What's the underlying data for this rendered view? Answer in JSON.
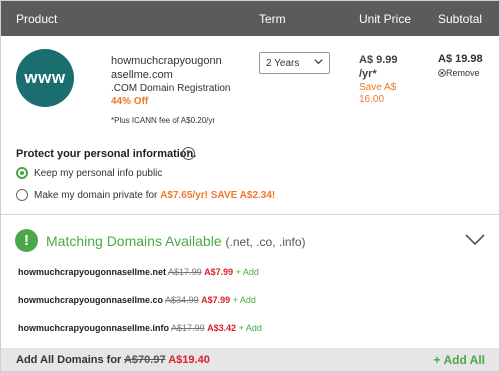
{
  "header": {
    "product": "Product",
    "term": "Term",
    "unit_price": "Unit Price",
    "subtotal": "Subtotal"
  },
  "item": {
    "logo_text": "www",
    "domain_line1": "howmuchcrapyougonn",
    "domain_line2": "asellme.com",
    "description": ".COM Domain Registration",
    "discount": "44% Off",
    "icann_note": "*Plus ICANN fee of A$0.20/yr",
    "term_value": "2 Years",
    "price_line1": "A$ 9.99",
    "price_line2": "/yr*",
    "save_line1": "Save A$",
    "save_line2": "16.00",
    "subtotal": "A$ 19.98",
    "remove_label": "Remove"
  },
  "privacy": {
    "title": "Protect your personal information.",
    "help_icon": "?",
    "option_public": "Keep my personal info public",
    "option_private_prefix": "Make my domain private for ",
    "option_private_offer": "A$7.65/yr! SAVE A$2.34!"
  },
  "matching": {
    "icon": "!",
    "title": "Matching Domains Available",
    "tlds": "(.net, .co, .info)",
    "domains": [
      {
        "name": "howmuchcrapyougonnasellme.net",
        "old_price": "A$17.99",
        "new_price": "A$7.99",
        "add": "+ Add"
      },
      {
        "name": "howmuchcrapyougonnasellme.co",
        "old_price": "A$34.99",
        "new_price": "A$7.99",
        "add": "+ Add"
      },
      {
        "name": "howmuchcrapyougonnasellme.info",
        "old_price": "A$17.99",
        "new_price": "A$3.42",
        "add": "+ Add"
      }
    ]
  },
  "footer": {
    "label": "Add All Domains for ",
    "old_price": "A$70.97",
    "new_price": "A$19.40",
    "add_all": "+ Add All"
  },
  "colors": {
    "header_bg": "#5b5b5b",
    "accent_green": "#4ba84a",
    "accent_orange": "#f0782d",
    "price_red": "#d9212a",
    "logo_teal": "#1b6e70"
  }
}
